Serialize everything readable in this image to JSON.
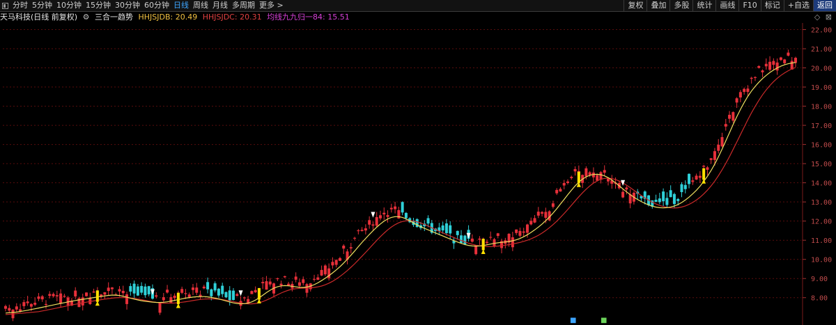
{
  "toolbar": {
    "periods": [
      "分时",
      "5分钟",
      "10分钟",
      "15分钟",
      "30分钟",
      "60分钟",
      "日线",
      "周线",
      "月线",
      "多周期",
      "更多 >"
    ],
    "active_period": "日线",
    "actions": [
      "复权",
      "叠加",
      "多股",
      "统计",
      "画线",
      "F10",
      "标记",
      "+自选",
      "返回"
    ]
  },
  "info": {
    "stock_name": "天马科技(日线 前复权)",
    "indicator_name": "三合一趋势",
    "jdb_label": "HHJSJDB: 20.49",
    "jdc_label": "HHJSJDC: 20.31",
    "ma_label": "均线九九归一84: 15.51"
  },
  "colors": {
    "up": "#e8303a",
    "down": "#2fd0d8",
    "jdb_line": "#f0e060",
    "jdc_line": "#cc2a2a",
    "grid": "#5a0d0d",
    "axis_text": "#c24c4c",
    "signal_yellow": "#ffe000",
    "counter_purple": "#c23bff",
    "counter_green": "#6bd35a"
  },
  "chart_data": {
    "type": "candlestick",
    "y_ticks": [
      "8.00",
      "9.00",
      "10.00",
      "11.00",
      "12.00",
      "13.00",
      "14.00",
      "15.00",
      "16.00",
      "17.00",
      "18.00",
      "19.00",
      "20.00",
      "21.00",
      "22.00"
    ],
    "ylim": [
      7.3,
      22.2
    ],
    "closes": [
      7.2,
      7.23,
      7.26,
      7.29,
      7.33,
      7.36,
      7.4,
      7.44,
      7.48,
      7.52,
      7.56,
      7.6,
      7.64,
      7.68,
      7.72,
      7.76,
      7.8,
      7.84,
      7.87,
      7.9,
      7.93,
      7.96,
      7.99,
      8.02,
      8.05,
      8.08,
      8.11,
      8.13,
      8.15,
      8.15,
      8.1,
      8.05,
      8.0,
      7.95,
      7.9,
      7.85,
      7.82,
      7.8,
      7.78,
      7.76,
      7.74,
      7.74,
      7.76,
      7.8,
      7.84,
      7.88,
      7.92,
      7.96,
      8.0,
      8.02,
      8.04,
      8.06,
      8.08,
      8.06,
      8.03,
      8.0,
      7.96,
      7.92,
      7.86,
      7.8,
      7.74,
      7.7,
      7.68,
      7.67,
      7.68,
      7.72,
      7.8,
      7.92,
      8.06,
      8.2,
      8.34,
      8.46,
      8.56,
      8.62,
      8.64,
      8.64,
      8.62,
      8.58,
      8.54,
      8.52,
      8.52,
      8.56,
      8.62,
      8.72,
      8.82,
      8.94,
      9.08,
      9.22,
      9.36,
      9.52,
      9.7,
      9.9,
      10.1,
      10.32,
      10.55,
      10.78,
      11.0,
      11.2,
      11.4,
      11.6,
      11.78,
      11.94,
      12.08,
      12.18,
      12.24,
      12.26,
      12.24,
      12.18,
      12.08,
      11.96,
      11.84,
      11.74,
      11.66,
      11.58,
      11.5,
      11.42,
      11.34,
      11.26,
      11.18,
      11.1,
      11.02,
      10.94,
      10.86,
      10.8,
      10.74,
      10.7,
      10.68,
      10.68,
      10.7,
      10.74,
      10.78,
      10.82,
      10.86,
      10.88,
      10.9,
      10.92,
      10.94,
      10.98,
      11.04,
      11.12,
      11.22,
      11.34,
      11.46,
      11.6,
      11.76,
      11.92,
      12.1,
      12.3,
      12.52,
      12.76,
      13.0,
      13.26,
      13.5,
      13.74,
      13.96,
      14.14,
      14.28,
      14.38,
      14.44,
      14.46,
      14.46,
      14.42,
      14.34,
      14.22,
      14.08,
      13.92,
      13.76,
      13.6,
      13.44,
      13.3,
      13.18,
      13.06,
      12.96,
      12.88,
      12.8,
      12.74,
      12.7,
      12.68,
      12.68,
      12.7,
      12.74,
      12.8,
      12.9,
      13.02,
      13.16,
      13.32,
      13.5,
      13.7,
      13.92,
      14.18,
      14.46,
      14.78,
      15.14,
      15.54,
      15.96,
      16.4,
      16.84,
      17.26,
      17.66,
      18.04,
      18.38,
      18.68,
      18.94,
      19.16,
      19.36,
      19.54,
      19.7,
      19.84,
      19.96,
      20.06,
      20.14,
      20.2,
      20.24,
      20.28,
      20.3,
      20.31
    ]
  }
}
